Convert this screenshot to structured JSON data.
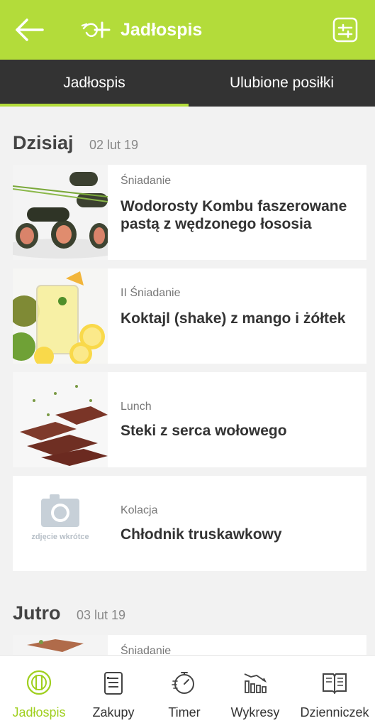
{
  "header": {
    "title": "Jadłospis"
  },
  "tabs": [
    {
      "label": "Jadłospis",
      "active": true
    },
    {
      "label": "Ulubione posiłki",
      "active": false
    }
  ],
  "days": [
    {
      "title": "Dzisiaj",
      "date": "02 lut 19",
      "meals": [
        {
          "meal": "Śniadanie",
          "name": "Wodorosty Kombu faszerowane pastą z wędzonego łososia"
        },
        {
          "meal": "II Śniadanie",
          "name": "Koktajl (shake) z mango i żółtek"
        },
        {
          "meal": "Lunch",
          "name": "Steki z serca wołowego"
        },
        {
          "meal": "Kolacja",
          "name": "Chłodnik truskawkowy",
          "photo_placeholder": "zdjęcie wkrótce"
        }
      ]
    },
    {
      "title": "Jutro",
      "date": "03 lut 19",
      "meals": [
        {
          "meal": "Śniadanie"
        }
      ]
    }
  ],
  "bottom_nav": [
    {
      "label": "Jadłospis",
      "icon": "plate-cutlery-icon",
      "active": true
    },
    {
      "label": "Zakupy",
      "icon": "shopping-list-icon",
      "active": false
    },
    {
      "label": "Timer",
      "icon": "timer-icon",
      "active": false
    },
    {
      "label": "Wykresy",
      "icon": "bar-chart-icon",
      "active": false
    },
    {
      "label": "Dzienniczek",
      "icon": "journal-icon",
      "active": false
    }
  ],
  "colors": {
    "accent": "#b3dc3a",
    "tab_bar": "#333333",
    "active_nav": "#9fcf1e"
  }
}
